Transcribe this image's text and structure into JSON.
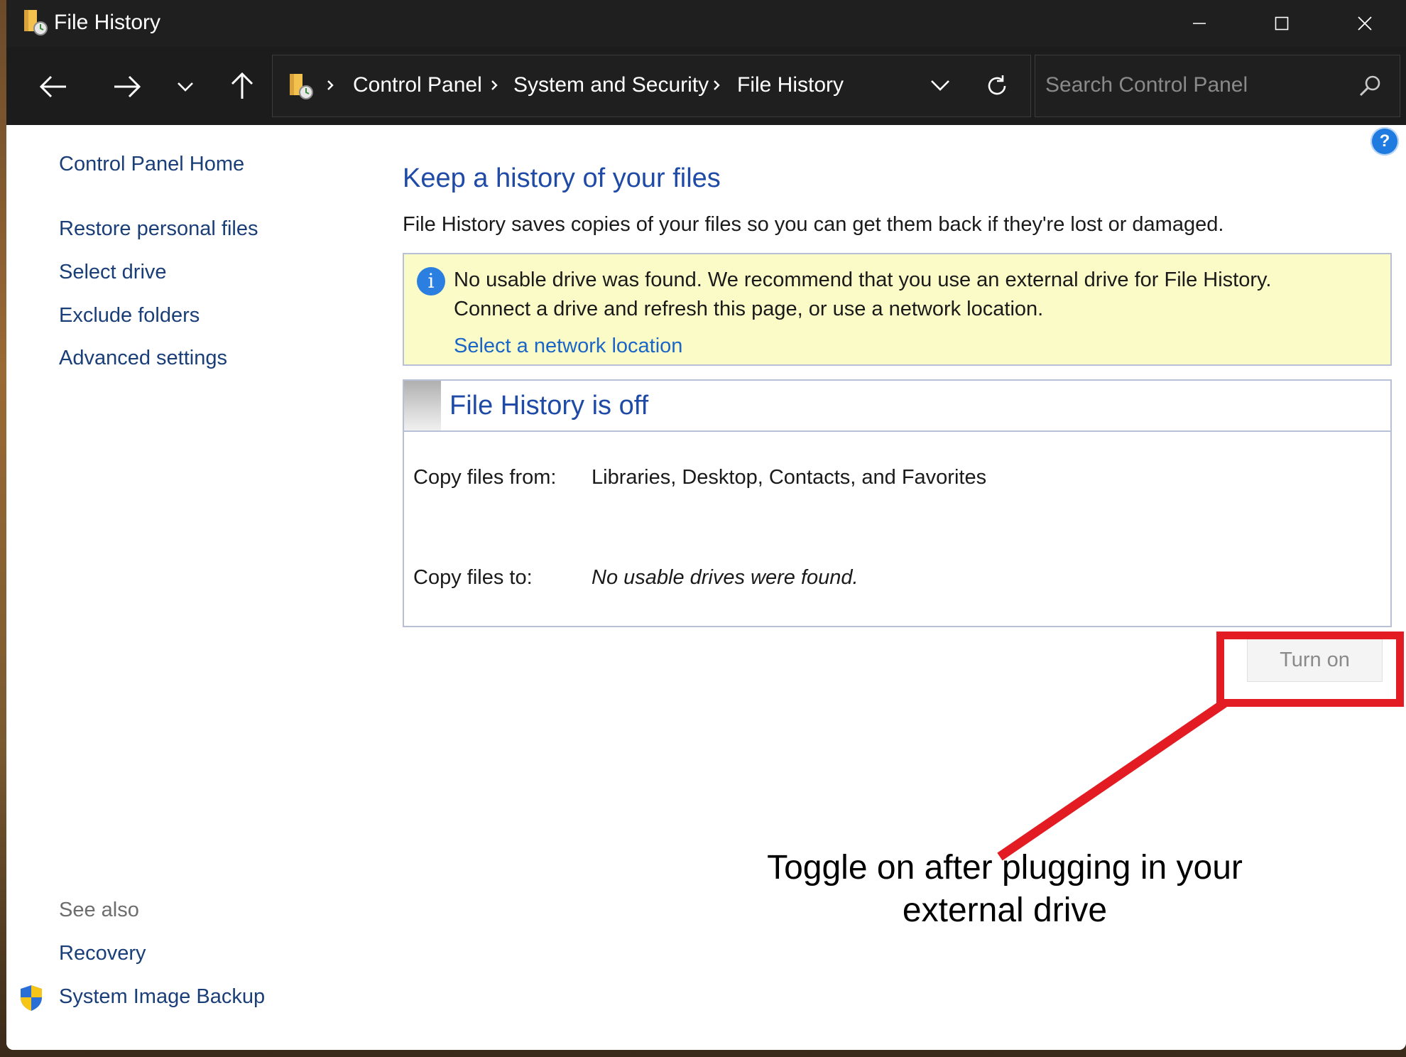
{
  "window": {
    "title": "File History"
  },
  "nav": {
    "breadcrumbs": [
      "Control Panel",
      "System and Security",
      "File History"
    ],
    "search_placeholder": "Search Control Panel"
  },
  "sidebar": {
    "home": "Control Panel Home",
    "links": [
      "Restore personal files",
      "Select drive",
      "Exclude folders",
      "Advanced settings"
    ],
    "see_also_label": "See also",
    "see_also_links": [
      "Recovery",
      "System Image Backup"
    ]
  },
  "main": {
    "heading": "Keep a history of your files",
    "description": "File History saves copies of your files so you can get them back if they're lost or damaged.",
    "info": {
      "line1": "No usable drive was found. We recommend that you use an external drive for File History.",
      "line2": "Connect a drive and refresh this page, or use a network location.",
      "link": "Select a network location",
      "icon_glyph": "i"
    },
    "status": {
      "title": "File History is off",
      "copy_from_label": "Copy files from:",
      "copy_from_value": "Libraries, Desktop, Contacts, and Favorites",
      "copy_to_label": "Copy files to:",
      "copy_to_value": "No usable drives were found."
    },
    "turn_on_label": "Turn on",
    "help_glyph": "?"
  },
  "annotation": {
    "line1": "Toggle on after plugging in your",
    "line2": "external drive",
    "color": "#e31b23"
  },
  "icons": {
    "back": "arrow-left-icon",
    "forward": "arrow-right-icon",
    "recent": "chevron-down-icon",
    "up": "arrow-up-icon",
    "refresh": "refresh-icon",
    "search": "search-icon",
    "folder": "file-history-folder-icon",
    "shield": "uac-shield-icon"
  }
}
